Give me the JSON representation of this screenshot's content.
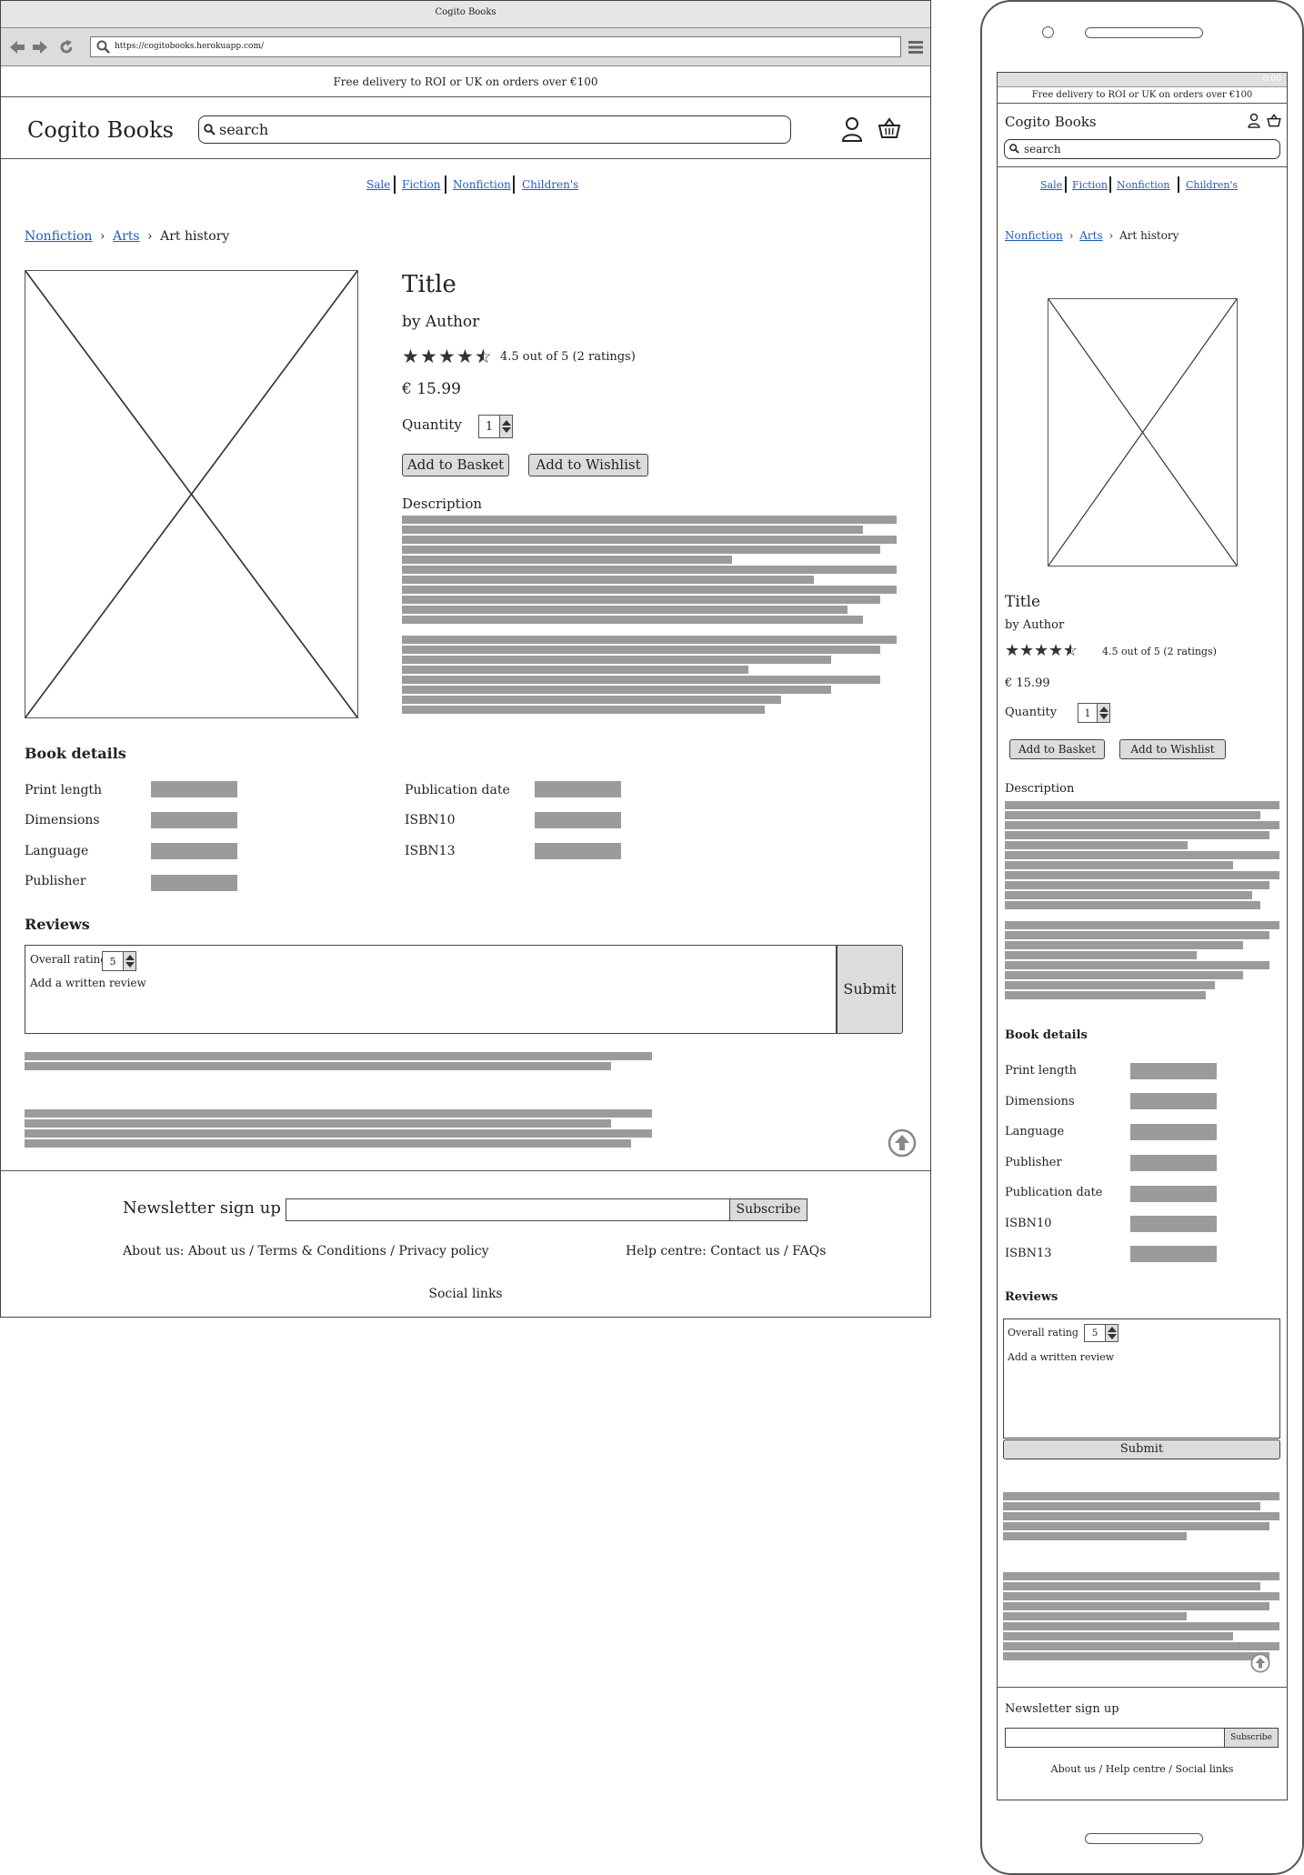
{
  "browser": {
    "title": "Cogito Books",
    "url": "https://cogitobooks.herokuapp.com/"
  },
  "site": {
    "promo": "Free delivery to ROI or UK on orders over €100",
    "logo": "Cogito Books",
    "search_placeholder": "search"
  },
  "nav": [
    "Sale",
    "Fiction",
    "Nonfiction",
    "Children's"
  ],
  "breadcrumb": {
    "level1": "Nonfiction",
    "level2": "Arts",
    "current": "Art history",
    "separator": "›"
  },
  "product": {
    "title": "Title",
    "author": "by Author",
    "rating": 4.5,
    "rating_text": "4.5 out of 5 (2 ratings)",
    "price": "€ 15.99",
    "quantity_label": "Quantity",
    "quantity_value": "1",
    "add_to_basket": "Add to Basket",
    "add_to_wishlist": "Add to Wishlist",
    "description_label": "Description"
  },
  "details": {
    "heading": "Book details",
    "fields": [
      "Print length",
      "Dimensions",
      "Language",
      "Publisher",
      "Publication date",
      "ISBN10",
      "ISBN13"
    ]
  },
  "reviews": {
    "heading": "Reviews",
    "overall_label": "Overall rating",
    "overall_value": "5",
    "placeholder": "Add a written review",
    "submit": "Submit"
  },
  "footer": {
    "newsletter_label": "Newsletter sign up",
    "subscribe": "Subscribe",
    "about": "About us: About us / Terms & Conditions / Privacy policy",
    "help": "Help centre: Contact us / FAQs",
    "social": "Social links",
    "mobile_links": "About us / Help centre / Social links"
  },
  "mobile": {
    "status_time": "0:00"
  },
  "icons": {
    "search": "search-icon",
    "user": "user-icon",
    "basket": "basket-icon",
    "back_to_top": "arrow-up-circle-icon"
  }
}
